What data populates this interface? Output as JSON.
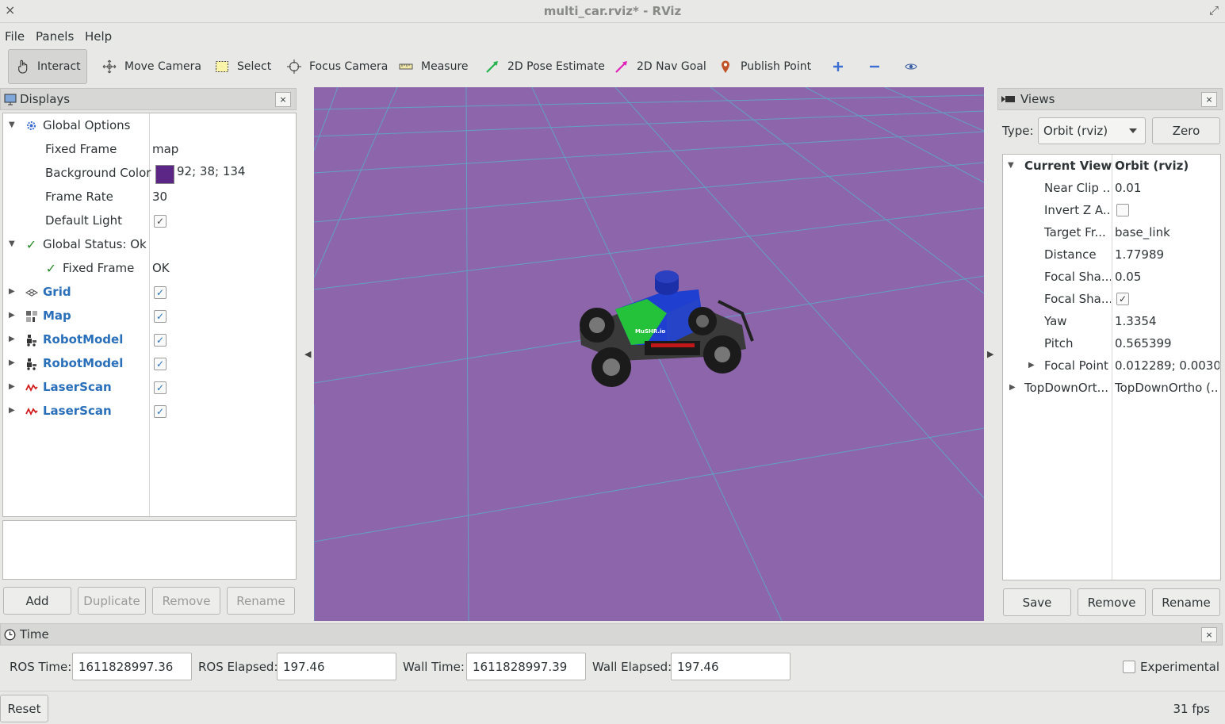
{
  "window": {
    "title": "multi_car.rviz* - RViz",
    "close_glyph": "×",
    "max_glyph": "⤢"
  },
  "menu": [
    "File",
    "Panels",
    "Help"
  ],
  "toolbar": {
    "tools": [
      {
        "label": "Interact",
        "icon": "hand-pointer-icon",
        "active": true
      },
      {
        "label": "Move Camera",
        "icon": "move-camera-icon"
      },
      {
        "label": "Select",
        "icon": "select-box-icon"
      },
      {
        "label": "Focus Camera",
        "icon": "focus-camera-icon"
      },
      {
        "label": "Measure",
        "icon": "ruler-icon"
      },
      {
        "label": "2D Pose Estimate",
        "icon": "green-arrow-icon"
      },
      {
        "label": "2D Nav Goal",
        "icon": "magenta-arrow-icon"
      },
      {
        "label": "Publish Point",
        "icon": "map-pin-icon"
      }
    ]
  },
  "displays": {
    "title": "Displays",
    "close_label": "×",
    "global_options": "Global Options",
    "fixed_frame_label": "Fixed Frame",
    "fixed_frame_value": "map",
    "bg_color_label": "Background Color",
    "bg_color_value": "92; 38; 134",
    "bg_color_hex": "#5c2686",
    "frame_rate_label": "Frame Rate",
    "frame_rate_value": "30",
    "default_light_label": "Default Light",
    "global_status": "Global Status: Ok",
    "status_fixed_frame": "Fixed Frame",
    "status_fixed_frame_value": "OK",
    "items": [
      "Grid",
      "Map",
      "RobotModel",
      "RobotModel",
      "LaserScan",
      "LaserScan"
    ],
    "buttons": {
      "add": "Add",
      "duplicate": "Duplicate",
      "remove": "Remove",
      "rename": "Rename"
    }
  },
  "views": {
    "title": "Views",
    "close_label": "×",
    "type_label": "Type:",
    "type_value": "Orbit (rviz)",
    "zero_label": "Zero",
    "current_view": "Current View",
    "current_view_value": "Orbit (rviz)",
    "props": [
      {
        "label": "Near Clip ...",
        "value": "0.01"
      },
      {
        "label": "Invert Z A...",
        "value": ""
      },
      {
        "label": "Target Fr...",
        "value": "base_link"
      },
      {
        "label": "Distance",
        "value": "1.77989"
      },
      {
        "label": "Focal Sha...",
        "value": "0.05"
      },
      {
        "label": "Focal Sha...",
        "value": ""
      },
      {
        "label": "Yaw",
        "value": "1.3354"
      },
      {
        "label": "Pitch",
        "value": "0.565399"
      },
      {
        "label": "Focal Point",
        "value": "0.012289; 0.0030..."
      }
    ],
    "saved": {
      "label": "TopDownOrt...",
      "value": "TopDownOrtho (..."
    },
    "buttons": {
      "save": "Save",
      "remove": "Remove",
      "rename": "Rename"
    }
  },
  "viewport": {
    "background": "#8d65ab",
    "grid_color": "#5fa6c8",
    "car_label": "MuSHR.io"
  },
  "time": {
    "title": "Time",
    "close_label": "×",
    "ros_time_label": "ROS Time:",
    "ros_time": "1611828997.36",
    "ros_elapsed_label": "ROS Elapsed:",
    "ros_elapsed": "197.46",
    "wall_time_label": "Wall Time:",
    "wall_time": "1611828997.39",
    "wall_elapsed_label": "Wall Elapsed:",
    "wall_elapsed": "197.46",
    "experimental_label": "Experimental"
  },
  "status": {
    "reset_label": "Reset",
    "fps": "31 fps"
  }
}
